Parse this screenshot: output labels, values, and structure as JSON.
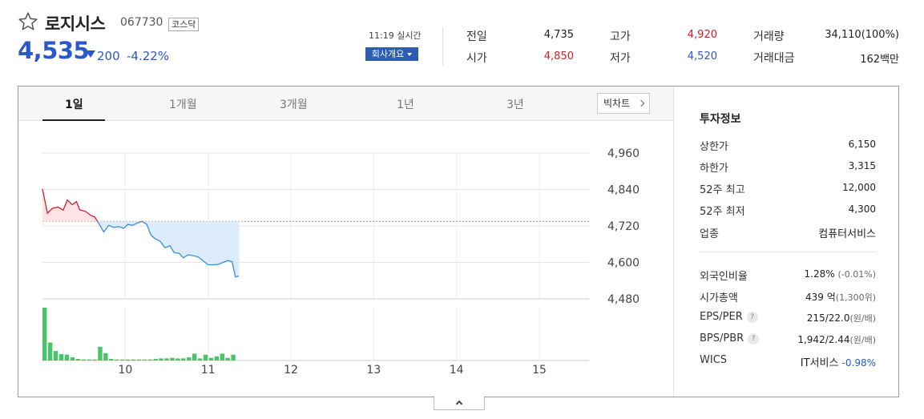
{
  "stock": {
    "name": "로지시스",
    "code": "067730",
    "market": "코스닥",
    "price": "4,535",
    "change": "200",
    "change_rate": "-4.22%",
    "direction": "down",
    "realtime": "11:19 실시간",
    "company_button": "회사개요"
  },
  "summary": [
    {
      "label": "전일",
      "value": "4,735",
      "color": "neutral"
    },
    {
      "label": "시가",
      "value": "4,850",
      "color": "red"
    },
    {
      "label": "고가",
      "value": "4,920",
      "color": "red"
    },
    {
      "label": "저가",
      "value": "4,520",
      "color": "blue"
    },
    {
      "label": "거래량",
      "value": "34,110(100%)",
      "color": "neutral"
    },
    {
      "label": "거래대금",
      "value": "162백만",
      "color": "neutral"
    }
  ],
  "tabs": [
    "1일",
    "1개월",
    "3개월",
    "1년",
    "3년"
  ],
  "big_chart_label": "빅차트",
  "chart_data": {
    "type": "line",
    "x_ticks": [
      "10",
      "11",
      "12",
      "13",
      "14",
      "15"
    ],
    "y_ticks": [
      "4,960",
      "4,840",
      "4,720",
      "4,600",
      "4,480"
    ],
    "ylim": [
      4480,
      4960
    ],
    "xlim": [
      9.0,
      15.6
    ],
    "baseline": 4735,
    "price_series": [
      [
        9.0,
        4842
      ],
      [
        9.06,
        4762
      ],
      [
        9.12,
        4778
      ],
      [
        9.19,
        4782
      ],
      [
        9.25,
        4772
      ],
      [
        9.3,
        4805
      ],
      [
        9.36,
        4790
      ],
      [
        9.41,
        4800
      ],
      [
        9.45,
        4773
      ],
      [
        9.52,
        4768
      ],
      [
        9.58,
        4755
      ],
      [
        9.63,
        4750
      ],
      [
        9.68,
        4728
      ],
      [
        9.74,
        4700
      ],
      [
        9.8,
        4722
      ],
      [
        9.86,
        4715
      ],
      [
        9.92,
        4718
      ],
      [
        9.98,
        4712
      ],
      [
        10.03,
        4725
      ],
      [
        10.09,
        4722
      ],
      [
        10.15,
        4730
      ],
      [
        10.2,
        4735
      ],
      [
        10.26,
        4725
      ],
      [
        10.31,
        4690
      ],
      [
        10.36,
        4678
      ],
      [
        10.42,
        4670
      ],
      [
        10.48,
        4648
      ],
      [
        10.54,
        4655
      ],
      [
        10.59,
        4632
      ],
      [
        10.65,
        4630
      ],
      [
        10.7,
        4615
      ],
      [
        10.76,
        4625
      ],
      [
        10.82,
        4622
      ],
      [
        10.88,
        4618
      ],
      [
        10.94,
        4605
      ],
      [
        11.0,
        4592
      ],
      [
        11.06,
        4592
      ],
      [
        11.12,
        4593
      ],
      [
        11.18,
        4600
      ],
      [
        11.24,
        4606
      ],
      [
        11.29,
        4602
      ],
      [
        11.33,
        4552
      ],
      [
        11.37,
        4555
      ]
    ],
    "volume": [
      100,
      34,
      18,
      12,
      11,
      6,
      3,
      2,
      2,
      2,
      26,
      14,
      3,
      2,
      2,
      2,
      2,
      2,
      2,
      2,
      3,
      4,
      4,
      5,
      4,
      4,
      6,
      13,
      4,
      11,
      5,
      8,
      13,
      5,
      11
    ],
    "volume_x_start": 9.0,
    "volume_x_step": 0.067
  },
  "investment_info": {
    "title": "투자정보",
    "rows_top": [
      {
        "label": "상한가",
        "value": "6,150",
        "color": "red"
      },
      {
        "label": "하한가",
        "value": "3,315",
        "color": "blue"
      },
      {
        "label": "52주 최고",
        "value": "12,000",
        "color": "neutral"
      },
      {
        "label": "52주 최저",
        "value": "4,300",
        "color": "neutral"
      },
      {
        "label": "업종",
        "value": "컴퓨터서비스",
        "color": "neutral"
      }
    ],
    "rows_bottom": [
      {
        "label": "외국인비율",
        "value": "1.28%",
        "sub": "(-0.01%)",
        "help": false
      },
      {
        "label": "시가총액",
        "value": "439 억",
        "sub": "(1,300위)",
        "help": false
      },
      {
        "label": "EPS/PER",
        "value": "215/22.0",
        "sub": "(원/배)",
        "help": true
      },
      {
        "label": "BPS/PBR",
        "value": "1,942/2.44",
        "sub": "(원/배)",
        "help": true
      },
      {
        "label": "WICS",
        "value": "IT서비스",
        "sub": "-0.98%",
        "help": false
      }
    ],
    "help_glyph": "?"
  },
  "colors": {
    "up": "#d0202a",
    "down": "#2a58c8",
    "volume": "#49c46b",
    "brand": "#2b5db0"
  }
}
